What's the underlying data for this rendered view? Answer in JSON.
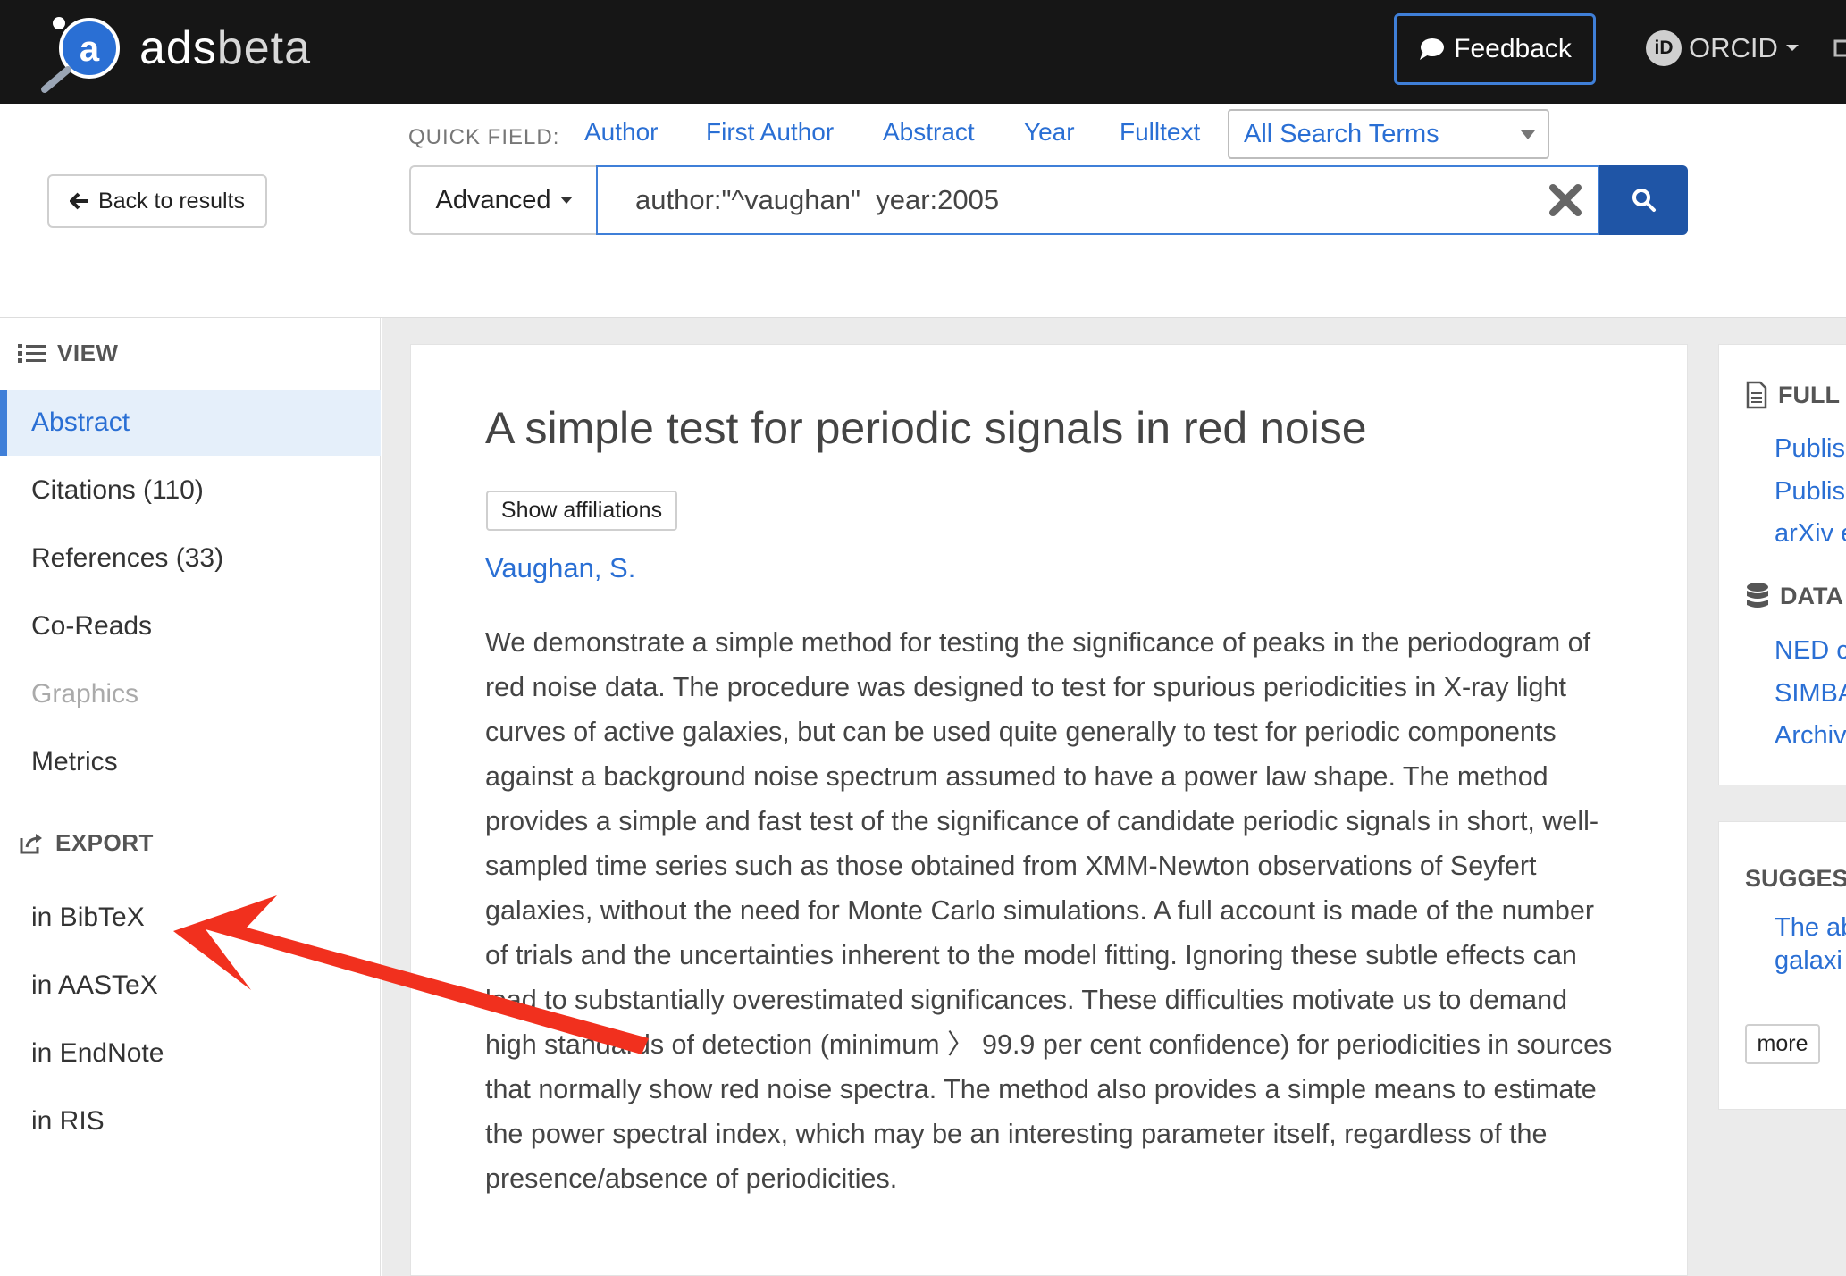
{
  "brand": {
    "name": "ads",
    "suffix": "beta",
    "logo_letter": "a"
  },
  "topbar": {
    "feedback_label": "Feedback",
    "orcid_label": "ORCID",
    "orcid_badge": "iD"
  },
  "search": {
    "back_label": "Back to results",
    "quick_field_label": "QUICK FIELD:",
    "quick_fields": [
      "Author",
      "First Author",
      "Abstract",
      "Year",
      "Fulltext"
    ],
    "terms_select": "All Search Terms",
    "advanced_label": "Advanced",
    "query": "author:\"^vaughan\"  year:2005"
  },
  "sidebar": {
    "view_heading": "VIEW",
    "view_items": [
      {
        "label": "Abstract",
        "state": "active"
      },
      {
        "label": "Citations (110)",
        "state": "normal"
      },
      {
        "label": "References (33)",
        "state": "normal"
      },
      {
        "label": "Co-Reads",
        "state": "normal"
      },
      {
        "label": "Graphics",
        "state": "disabled"
      },
      {
        "label": "Metrics",
        "state": "normal"
      }
    ],
    "export_heading": "EXPORT",
    "export_items": [
      "in BibTeX",
      "in AASTeX",
      "in EndNote",
      "in RIS"
    ]
  },
  "paper": {
    "title": "A simple test for periodic signals in red noise",
    "affiliations_button": "Show affiliations",
    "author": "Vaughan, S.",
    "abstract": "We demonstrate a simple method for testing the significance of peaks in the periodogram of red noise data. The procedure was designed to test for spurious periodicities in X-ray light curves of active galaxies, but can be used quite generally to test for periodic components against a background noise spectrum assumed to have a power law shape. The method provides a simple and fast test of the significance of candidate periodic signals in short, well-sampled time series such as those obtained from XMM-Newton observations of Seyfert galaxies, without the need for Monte Carlo simulations. A full account is made of the number of trials and the uncertainties inherent to the model fitting. Ignoring these subtle effects can lead to substantially overestimated significances. These difficulties motivate us to demand high standards of detection (minimum 〉 99.9 per cent confidence) for periodicities in sources that normally show red noise spectra. The method also provides a simple means to estimate the power spectral index, which may be an interesting parameter itself, regardless of the presence/absence of periodicities."
  },
  "right_panel": {
    "fulltext_heading": "FULL",
    "fulltext_links": [
      "Publis",
      "Publis",
      "arXiv e"
    ],
    "data_heading": "DATA",
    "data_links": [
      "NED c",
      "SIMBA",
      "Archiv"
    ],
    "suggested_heading": "SUGGES",
    "suggested_text": "The ab the X- galaxi",
    "more_label": "more"
  },
  "colors": {
    "topbar": "#161616",
    "link": "#2a6fd4",
    "accent": "#3f7fd8",
    "search_button": "#1f55a6",
    "annotation_arrow": "#f1301e"
  },
  "icons": [
    "search-icon",
    "close-icon",
    "arrow-left-icon",
    "list-icon",
    "share-icon",
    "comment-icon",
    "document-icon",
    "database-icon"
  ]
}
